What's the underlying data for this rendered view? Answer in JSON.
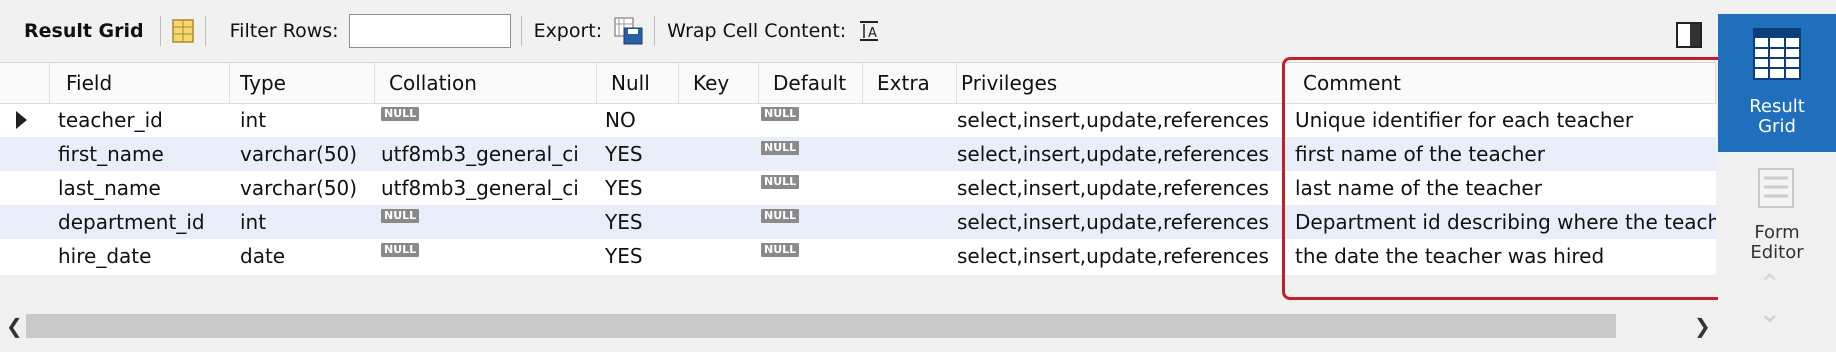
{
  "toolbar": {
    "result_grid_label": "Result Grid",
    "filter_rows_label": "Filter Rows:",
    "filter_rows_value": "",
    "export_label": "Export:",
    "wrap_cell_label": "Wrap Cell Content:"
  },
  "grid": {
    "columns": [
      "Field",
      "Type",
      "Collation",
      "Null",
      "Key",
      "Default",
      "Extra",
      "Privileges",
      "Comment"
    ],
    "null_text": "NULL",
    "rows": [
      {
        "field": "teacher_id",
        "type": "int",
        "collation": null,
        "null": "NO",
        "key": "",
        "default": null,
        "extra": "",
        "privileges": "select,insert,update,references",
        "comment": "Unique identifier for each teacher"
      },
      {
        "field": "first_name",
        "type": "varchar(50)",
        "collation": "utf8mb3_general_ci",
        "null": "YES",
        "key": "",
        "default": null,
        "extra": "",
        "privileges": "select,insert,update,references",
        "comment": "first name of the teacher"
      },
      {
        "field": "last_name",
        "type": "varchar(50)",
        "collation": "utf8mb3_general_ci",
        "null": "YES",
        "key": "",
        "default": null,
        "extra": "",
        "privileges": "select,insert,update,references",
        "comment": "last name of the teacher"
      },
      {
        "field": "department_id",
        "type": "int",
        "collation": null,
        "null": "YES",
        "key": "",
        "default": null,
        "extra": "",
        "privileges": "select,insert,update,references",
        "comment": "Department id describing where the teacher"
      },
      {
        "field": "hire_date",
        "type": "date",
        "collation": null,
        "null": "YES",
        "key": "",
        "default": null,
        "extra": "",
        "privileges": "select,insert,update,references",
        "comment": "the date the teacher was hired"
      }
    ]
  },
  "side_panel": {
    "result_grid_line1": "Result",
    "result_grid_line2": "Grid",
    "form_editor_line1": "Form",
    "form_editor_line2": "Editor"
  },
  "colors": {
    "accent": "#1f6fbd",
    "highlight_border": "#c0202a",
    "alt_row": "#e8effa"
  },
  "icons": [
    "grid-icon",
    "export-save-icon",
    "wrap-text-icon",
    "panel-toggle-icon",
    "result-grid-icon",
    "form-editor-icon",
    "chevron-up-icon",
    "chevron-down-icon",
    "row-pointer-icon",
    "scroll-left-icon",
    "scroll-right-icon"
  ]
}
